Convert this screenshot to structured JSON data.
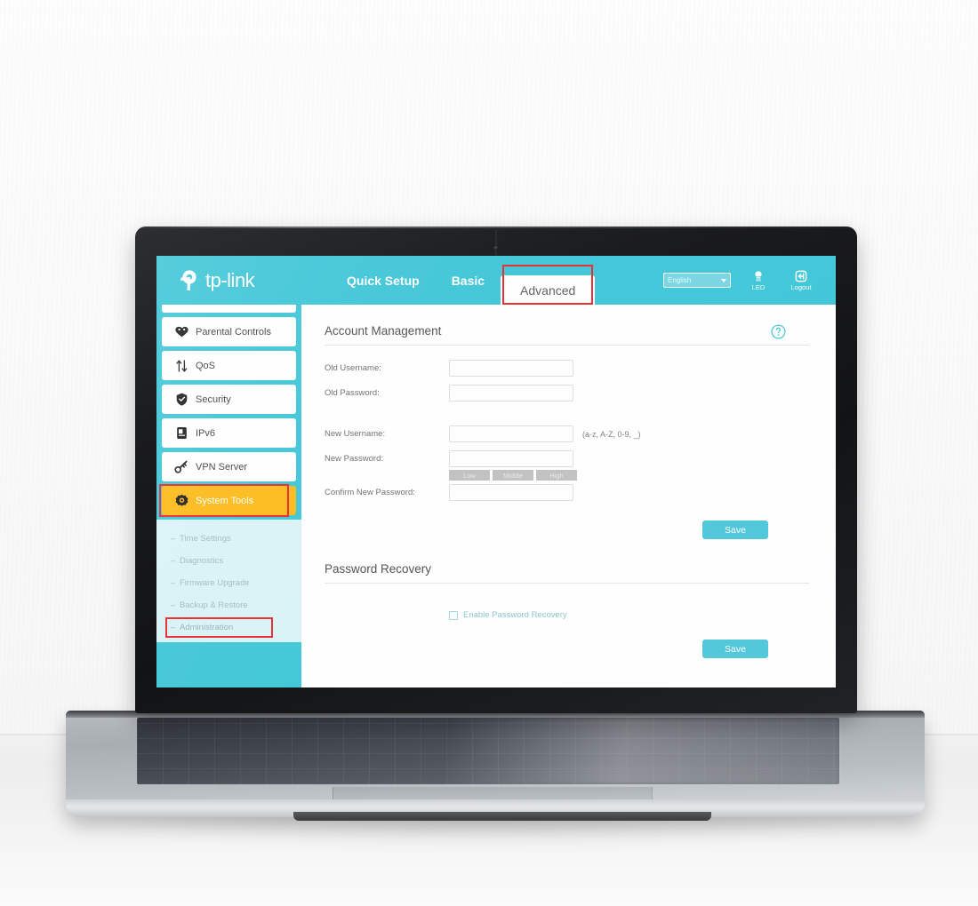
{
  "header": {
    "brand": "tp-link",
    "tabs": [
      {
        "label": "Quick Setup",
        "active": false
      },
      {
        "label": "Basic",
        "active": false
      },
      {
        "label": "Advanced",
        "active": true
      }
    ],
    "language": "English",
    "led_label": "LED",
    "logout_label": "Logout"
  },
  "sidebar": {
    "items": [
      {
        "label": "Parental Controls",
        "icon": "heart-icon",
        "active": false
      },
      {
        "label": "QoS",
        "icon": "updown-arrows-icon",
        "active": false
      },
      {
        "label": "Security",
        "icon": "shield-icon",
        "active": false
      },
      {
        "label": "IPv6",
        "icon": "document-icon",
        "active": false
      },
      {
        "label": "VPN Server",
        "icon": "link-chain-icon",
        "active": false
      },
      {
        "label": "System Tools",
        "icon": "gear-icon",
        "active": true
      }
    ],
    "submenu": [
      {
        "label": "Time Settings",
        "highlighted": false
      },
      {
        "label": "Diagnostics",
        "highlighted": false
      },
      {
        "label": "Firmware Upgrade",
        "highlighted": false
      },
      {
        "label": "Backup & Restore",
        "highlighted": false
      },
      {
        "label": "Administration",
        "highlighted": true
      }
    ],
    "dash": "–"
  },
  "account_management": {
    "title": "Account Management",
    "fields": [
      {
        "label": "Old Username:",
        "value": "",
        "hint": ""
      },
      {
        "label": "Old Password:",
        "value": "",
        "hint": ""
      },
      {
        "label": "New Username:",
        "value": "",
        "hint": "(a-z, A-Z, 0-9, _)"
      },
      {
        "label": "New Password:",
        "value": "",
        "hint": ""
      },
      {
        "label": "Confirm New Password:",
        "value": "",
        "hint": ""
      }
    ],
    "strength": [
      "Low",
      "Middle",
      "High"
    ],
    "save_label": "Save"
  },
  "password_recovery": {
    "title": "Password Recovery",
    "checkbox_label": "Enable Password Recovery",
    "checked": false,
    "save_label": "Save"
  },
  "colors": {
    "brand_teal": "#3ac5d6",
    "button_teal": "#4bc6d8",
    "active_item": "#fdb913",
    "highlight_red": "#e8232a",
    "submenu_bg": "#d9f3f7"
  }
}
